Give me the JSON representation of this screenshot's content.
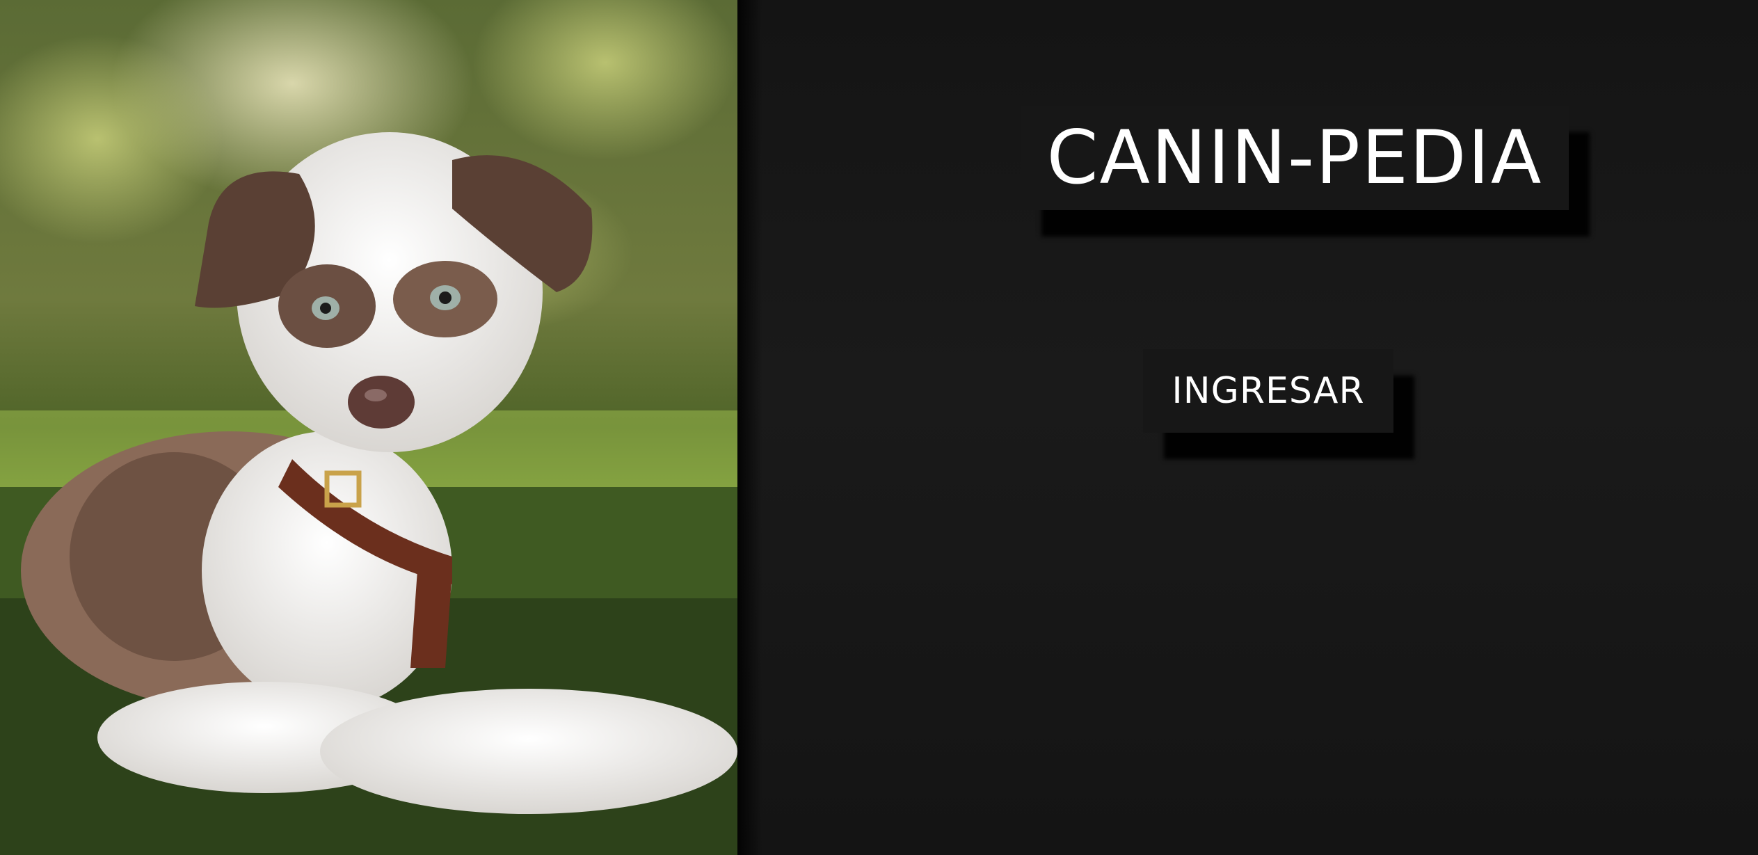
{
  "app": {
    "title": "CANIN-PEDIA"
  },
  "hero": {
    "image_subject": "puppy-photo"
  },
  "actions": {
    "enter_label": "INGRESAR"
  },
  "colors": {
    "background": "#141414",
    "panel": "#171717",
    "text": "#ffffff"
  }
}
